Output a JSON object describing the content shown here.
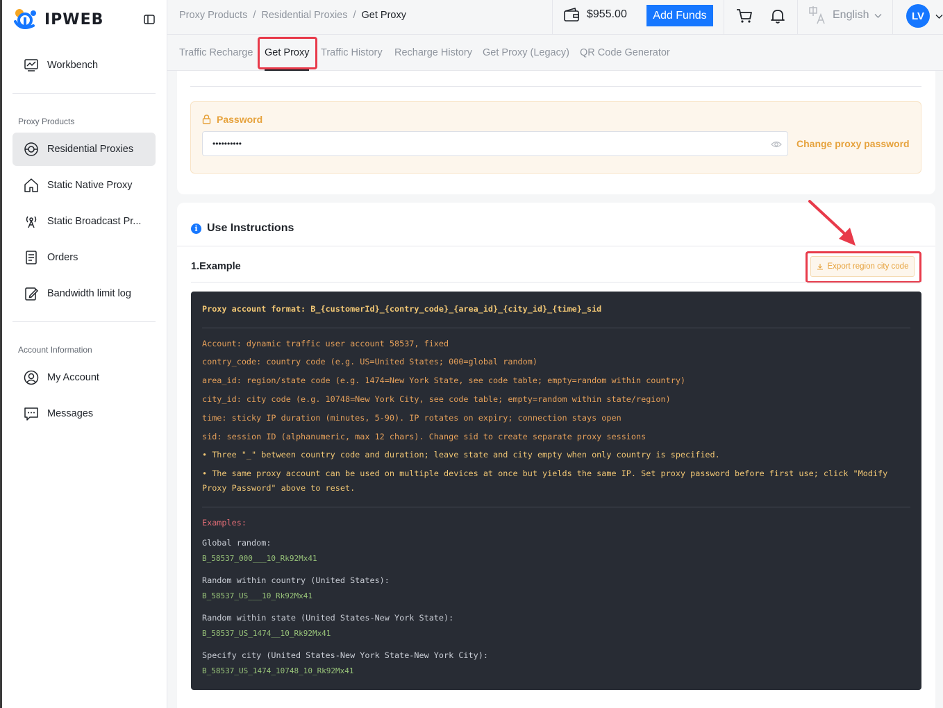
{
  "brand": {
    "name": "IPWEB"
  },
  "sidebar": {
    "workbench": "Workbench",
    "section_proxy": "Proxy Products",
    "items": [
      {
        "label": "Residential Proxies",
        "icon": "residential-icon"
      },
      {
        "label": "Static Native Proxy",
        "icon": "home-icon"
      },
      {
        "label": "Static Broadcast Pr...",
        "icon": "broadcast-icon"
      },
      {
        "label": "Orders",
        "icon": "orders-icon"
      },
      {
        "label": "Bandwidth limit log",
        "icon": "edit-log-icon"
      }
    ],
    "section_account": "Account Information",
    "account_items": [
      {
        "label": "My Account",
        "icon": "user-icon"
      },
      {
        "label": "Messages",
        "icon": "message-icon"
      }
    ]
  },
  "header": {
    "breadcrumb": [
      "Proxy Products",
      "Residential Proxies",
      "Get Proxy"
    ],
    "separator": "/",
    "balance": "$955.00",
    "add_funds": "Add Funds",
    "language": "English",
    "avatar": "LV"
  },
  "tabs": [
    "Traffic Recharge",
    "Get Proxy",
    "Traffic History",
    "Recharge History",
    "Get Proxy (Legacy)",
    "QR Code Generator"
  ],
  "active_tab": "Get Proxy",
  "password": {
    "label": "Password",
    "value": "••••••••••",
    "change_link": "Change proxy password"
  },
  "instructions": {
    "title": "Use Instructions",
    "example_title": "1.Example",
    "export_button": "Export region city code",
    "format_line": "Proxy account format: B_{customerId}_{contry_code}_{area_id}_{city_id}_{time}_sid",
    "details": [
      "Account: dynamic traffic user account 58537, fixed",
      "contry_code: country code (e.g. US=United States; 000=global random)",
      "area_id: region/state code (e.g. 1474=New York State, see code table; empty=random within country)",
      "city_id: city code (e.g. 10748=New York City, see code table; empty=random within state/region)",
      "time: sticky IP duration (minutes, 5-90). IP rotates on expiry; connection stays open",
      "sid: session ID (alphanumeric, max 12 chars). Change sid to create separate proxy sessions"
    ],
    "notes": [
      "• Three \"_\" between country code and duration; leave state and city empty when only country is specified.",
      "• The same proxy account can be used on multiple devices at once but yields the same IP. Set proxy password before first use; click \"Modify",
      "Proxy Password\" above to reset."
    ],
    "examples_label": "Examples:",
    "examples": [
      {
        "label": "Global random:",
        "value": "B_58537_000___10_Rk92Mx41"
      },
      {
        "label": "Random within country (United States):",
        "value": "B_58537_US___10_Rk92Mx41"
      },
      {
        "label": "Random within state (United States-New York State):",
        "value": "B_58537_US_1474__10_Rk92Mx41"
      },
      {
        "label": "Specify city (United States-New York State-New York City):",
        "value": "B_58537_US_1474_10748_10_Rk92Mx41"
      }
    ]
  },
  "colors": {
    "accent": "#1677ff",
    "warning": "#e6a23c",
    "highlight": "#e83a4a",
    "code_bg": "#282c34"
  }
}
